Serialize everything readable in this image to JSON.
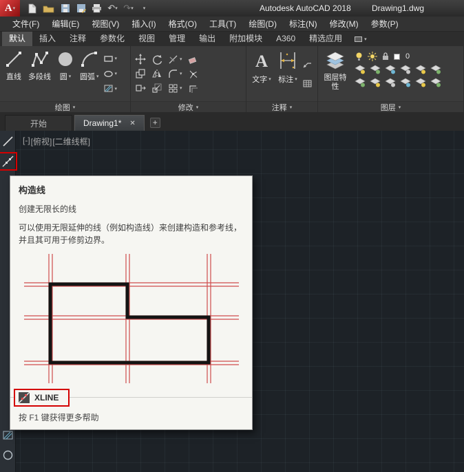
{
  "window": {
    "app_title": "Autodesk AutoCAD 2018",
    "doc_title": "Drawing1.dwg"
  },
  "menu": {
    "items": [
      "文件(F)",
      "编辑(E)",
      "视图(V)",
      "插入(I)",
      "格式(O)",
      "工具(T)",
      "绘图(D)",
      "标注(N)",
      "修改(M)",
      "参数(P)"
    ]
  },
  "ribbon": {
    "tabs": [
      "默认",
      "插入",
      "注释",
      "参数化",
      "视图",
      "管理",
      "输出",
      "附加模块",
      "A360",
      "精选应用"
    ],
    "panels": {
      "draw": {
        "label": "绘图",
        "line": "直线",
        "polyline": "多段线",
        "circle": "圆",
        "arc": "圆弧"
      },
      "modify": {
        "label": "修改"
      },
      "annotation": {
        "label": "注释",
        "text": "文字",
        "dimension": "标注"
      },
      "layers": {
        "label": "图层",
        "properties": "图层特性",
        "current_layer": "0"
      }
    }
  },
  "file_tabs": {
    "start": "开始",
    "drawing": "Drawing1*"
  },
  "viewport": {
    "controls_minus": "[-]",
    "controls_view": "[俯视]",
    "controls_visual": "[二维线框]"
  },
  "tooltip": {
    "title": "构造线",
    "summary": "创建无限长的线",
    "description": "可以使用无限延伸的线（例如构造线）来创建构造和参考线，并且其可用于修剪边界。",
    "command": "XLINE",
    "help": "按 F1 键获得更多帮助"
  },
  "glyphs": {
    "caret": "▾",
    "close": "✕",
    "plus": "+",
    "undo": "↶",
    "redo": "↷",
    "logo_letter": "A"
  }
}
